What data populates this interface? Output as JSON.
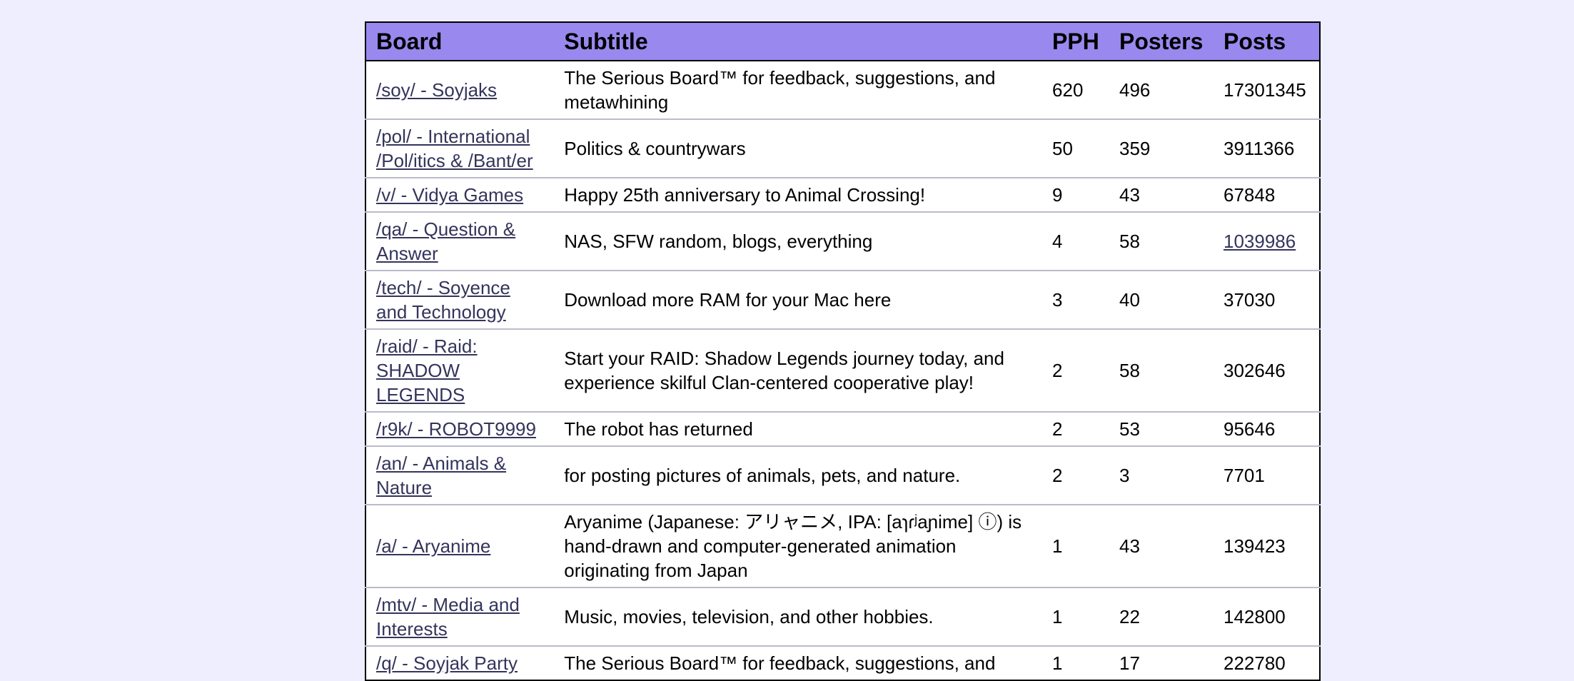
{
  "table": {
    "headers": {
      "board": "Board",
      "subtitle": "Subtitle",
      "pph": "PPH",
      "posters": "Posters",
      "posts": "Posts"
    },
    "rows": [
      {
        "board": "/soy/ - Soyjaks",
        "subtitle": "The Serious Board™ for feedback, suggestions, and metawhining",
        "pph": "620",
        "posters": "496",
        "posts": "17301345"
      },
      {
        "board": "/pol/ - International /Pol/itics & /Bant/er",
        "subtitle": "Politics & countrywars",
        "pph": "50",
        "posters": "359",
        "posts": "3911366"
      },
      {
        "board": "/v/ - Vidya Games",
        "subtitle": "Happy 25th anniversary to Animal Crossing!",
        "pph": "9",
        "posters": "43",
        "posts": "67848"
      },
      {
        "board": "/qa/ - Question & Answer",
        "subtitle": "NAS, SFW random, blogs, everything",
        "pph": "4",
        "posters": "58",
        "posts": "1039986"
      },
      {
        "board": "/tech/ - Soyence and Technology",
        "subtitle": "Download more RAM for your Mac here",
        "pph": "3",
        "posters": "40",
        "posts": "37030"
      },
      {
        "board": "/raid/ - Raid: SHADOW LEGENDS",
        "subtitle": "Start your RAID: Shadow Legends journey today, and experience skilful Clan-centered cooperative play!",
        "pph": "2",
        "posters": "58",
        "posts": "302646"
      },
      {
        "board": "/r9k/ - ROBOT9999",
        "subtitle": "The robot has returned",
        "pph": "2",
        "posters": "53",
        "posts": "95646"
      },
      {
        "board": "/an/ - Animals & Nature",
        "subtitle": "for posting pictures of animals, pets, and nature.",
        "pph": "2",
        "posters": "3",
        "posts": "7701"
      },
      {
        "board": "/a/ - Aryanime",
        "subtitle": "Aryanime (Japanese: アリャニメ, IPA: [aɿɾʲaɲime] ⓘ) is hand-drawn and computer-generated animation originating from Japan",
        "pph": "1",
        "posters": "43",
        "posts": "139423"
      },
      {
        "board": "/mtv/ - Media and Interests",
        "subtitle": "Music, movies, television, and other hobbies.",
        "pph": "1",
        "posters": "22",
        "posts": "142800"
      },
      {
        "board": "/q/ - Soyjak Party",
        "subtitle": "The Serious Board™ for feedback, suggestions, and",
        "pph": "1",
        "posters": "17",
        "posts": "222780"
      }
    ]
  }
}
